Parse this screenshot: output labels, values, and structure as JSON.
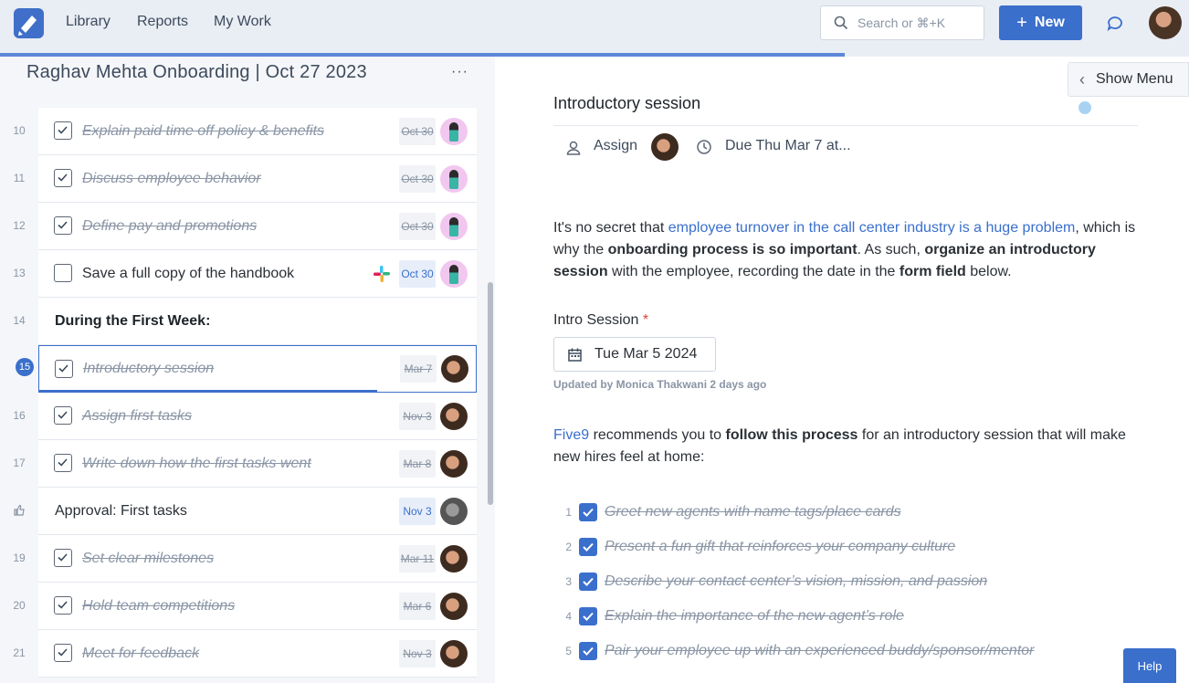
{
  "nav": {
    "links": [
      "Library",
      "Reports",
      "My Work"
    ],
    "search_placeholder": "Search or ⌘+K",
    "new_label": "New"
  },
  "checklist": {
    "title": "Raghav Mehta Onboarding | Oct 27 2023",
    "more": "···",
    "rows": [
      {
        "num": "10",
        "label": "Explain paid time off policy & benefits",
        "due": "Oct 30",
        "done": true
      },
      {
        "num": "11",
        "label": "Discuss employee behavior",
        "due": "Oct 30",
        "done": true
      },
      {
        "num": "12",
        "label": "Define pay and promotions",
        "due": "Oct 30",
        "done": true
      },
      {
        "num": "13",
        "label": "Save a full copy of the handbook",
        "due": "Oct 30",
        "done": false
      },
      {
        "num": "14",
        "label": "During the First Week:"
      },
      {
        "num": "15",
        "label": "Introductory session",
        "due": "Mar 7",
        "done": true
      },
      {
        "num": "16",
        "label": "Assign first tasks",
        "due": "Nov 3",
        "done": true
      },
      {
        "num": "17",
        "label": "Write down how the first tasks went",
        "due": "Mar 8",
        "done": true
      },
      {
        "num": "",
        "label": "Approval: First tasks",
        "due": "Nov 3"
      },
      {
        "num": "19",
        "label": "Set clear milestones",
        "due": "Mar 11",
        "done": true
      },
      {
        "num": "20",
        "label": "Hold team competitions",
        "due": "Mar 6",
        "done": true
      },
      {
        "num": "21",
        "label": "Meet for feedback",
        "due": "Nov 3",
        "done": true
      }
    ]
  },
  "detail": {
    "show_menu": "Show Menu",
    "title": "Introductory session",
    "assign": "Assign",
    "due": "Due Thu Mar 7 at...",
    "para1_link": "employee turnover in the call center industry is a huge problem",
    "para1_a": "It's no secret that ",
    "para1_b": ", which is why the ",
    "para1_bold1": "onboarding process is so important",
    "para1_c": ". As such, ",
    "para1_bold2": "organize an introductory session",
    "para1_d": " with the employee, recording the date in the ",
    "para1_bold3": "form field",
    "para1_e": " below.",
    "field_label": "Intro Session",
    "field_required": "*",
    "field_value": "Tue Mar 5 2024",
    "updated": "Updated by Monica Thakwani 2 days ago",
    "para2_link": "Five9",
    "para2_a": " recommends you to ",
    "para2_bold": "follow this process",
    "para2_b": " for an introductory session that will make new hires feel at home:",
    "subtasks": [
      {
        "n": "1",
        "label": "Greet new agents with name tags/place cards"
      },
      {
        "n": "2",
        "label": "Present a fun gift that reinforces your company culture"
      },
      {
        "n": "3",
        "label": "Describe your contact center’s vision, mission, and passion"
      },
      {
        "n": "4",
        "label": "Explain the importance of the new agent’s role"
      },
      {
        "n": "5",
        "label": "Pair your employee up with an experienced buddy/sponsor/mentor"
      }
    ],
    "help": "Help"
  }
}
